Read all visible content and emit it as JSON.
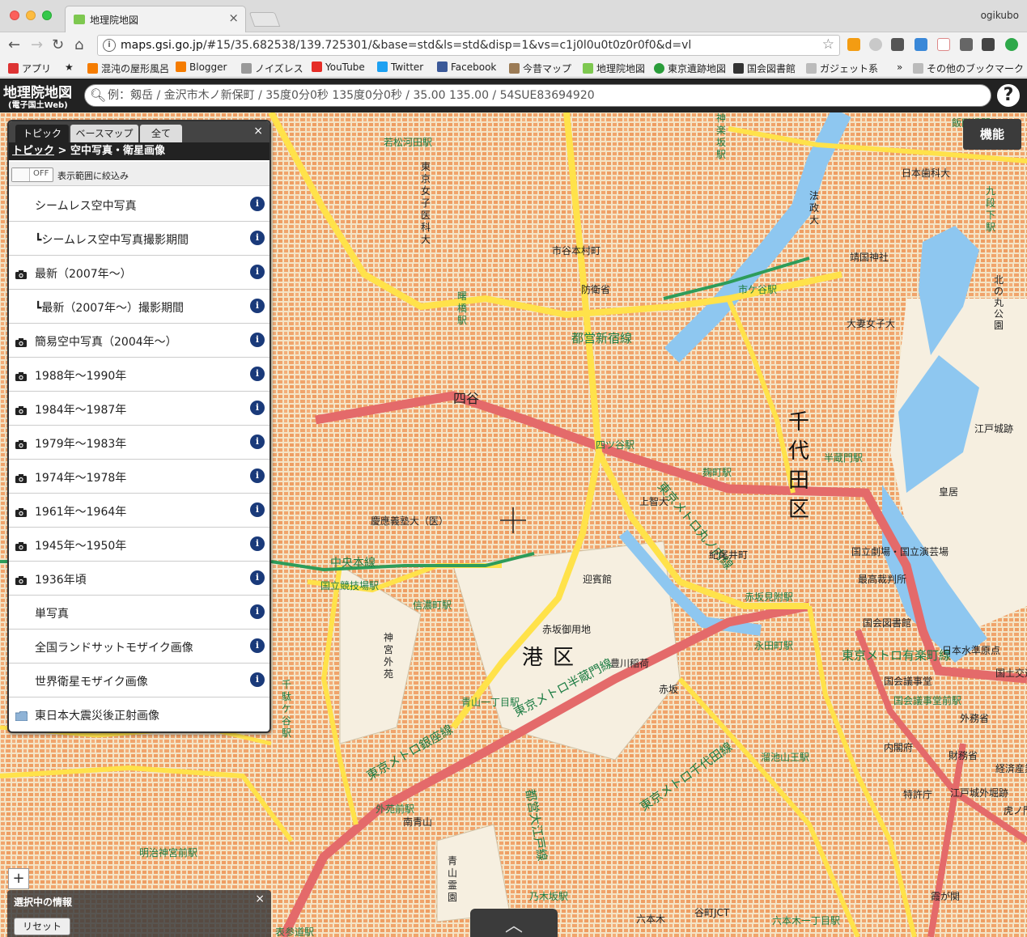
{
  "browser": {
    "tab_title": "地理院地図",
    "profile": "ogikubo",
    "url_host": "maps.gsi.go.jp",
    "url_rest": "/#15/35.682538/139.725301/&base=std&ls=std&disp=1&vs=c1j0l0u0t0z0r0f0&d=vl",
    "bookmarks": [
      "アプリ",
      "混沌の屋形風呂",
      "Blogger",
      "ノイズレス",
      "YouTube",
      "Twitter",
      "Facebook",
      "今昔マップ",
      "地理院地図",
      "東京遺跡地図",
      "国会図書館",
      "ガジェット系",
      "その他のブックマーク"
    ],
    "bookmarks_more": "»"
  },
  "gsi": {
    "logo": "地理院地図",
    "logo_sub": "(電子国土Web)",
    "search_placeholder": "例：剱岳 / 金沢市木ノ新保町 / 35度0分0秒 135度0分0秒 / 35.00 135.00 / 54SUE83694920",
    "help": "?",
    "kino_button": "機能"
  },
  "panel": {
    "tabs": [
      "トピック",
      "ベースマップ",
      "全て"
    ],
    "close": "×",
    "breadcrumb_root": "トピック",
    "breadcrumb_sep": " > ",
    "breadcrumb_current": "空中写真・衛星画像",
    "toggle_text": "OFF",
    "filter_label": "表示範囲に絞込み",
    "items": [
      {
        "label": "シームレス空中写真",
        "icon": "none",
        "info": true
      },
      {
        "label": "┗シームレス空中写真撮影期間",
        "icon": "none",
        "info": true
      },
      {
        "label": "最新（2007年～）",
        "icon": "camera",
        "info": true
      },
      {
        "label": "┗最新（2007年～）撮影期間",
        "icon": "none",
        "info": true
      },
      {
        "label": "簡易空中写真（2004年～）",
        "icon": "camera",
        "info": true
      },
      {
        "label": "1988年～1990年",
        "icon": "camera",
        "info": true
      },
      {
        "label": "1984年～1987年",
        "icon": "camera",
        "info": true
      },
      {
        "label": "1979年～1983年",
        "icon": "camera",
        "info": true
      },
      {
        "label": "1974年～1978年",
        "icon": "camera",
        "info": true
      },
      {
        "label": "1961年～1964年",
        "icon": "camera",
        "info": true
      },
      {
        "label": "1945年～1950年",
        "icon": "camera",
        "info": true
      },
      {
        "label": "1936年頃",
        "icon": "camera",
        "info": true
      },
      {
        "label": "単写真",
        "icon": "none",
        "info": true
      },
      {
        "label": "全国ランドサットモザイク画像",
        "icon": "none",
        "info": true
      },
      {
        "label": "世界衛星モザイク画像",
        "icon": "none",
        "info": true
      },
      {
        "label": "東日本大震災後正射画像",
        "icon": "folder",
        "info": false
      }
    ],
    "info_glyph": "i"
  },
  "selection": {
    "title": "選択中の情報",
    "close": "×",
    "reset": "リセット"
  },
  "map": {
    "zoom_in": "+",
    "bottom_tab": "︿",
    "labels": [
      {
        "text": "千代田区",
        "big": true
      },
      {
        "text": "港区",
        "big": true
      },
      {
        "text": "都営新宿線"
      },
      {
        "text": "東京メトロ丸ノ内線"
      },
      {
        "text": "東京メトロ銀座線"
      },
      {
        "text": "東京メトロ半蔵門線"
      },
      {
        "text": "東京メトロ有楽町線"
      },
      {
        "text": "東京メトロ千代田線"
      },
      {
        "text": "都営大江戸線"
      },
      {
        "text": "中央本線"
      },
      {
        "text": "国立競技場駅"
      },
      {
        "text": "信濃町駅"
      },
      {
        "text": "四ツ谷駅"
      },
      {
        "text": "市ケ谷駅"
      },
      {
        "text": "麹町駅"
      },
      {
        "text": "半蔵門駅"
      },
      {
        "text": "永田町駅"
      },
      {
        "text": "赤坂見附駅"
      },
      {
        "text": "国会議事堂前駅"
      },
      {
        "text": "外苑前駅"
      },
      {
        "text": "青山一丁目駅"
      },
      {
        "text": "明治神宮前駅"
      },
      {
        "text": "表参道駅"
      },
      {
        "text": "赤坂御用地"
      },
      {
        "text": "迎賓館"
      },
      {
        "text": "防衛省"
      },
      {
        "text": "国立劇場・国立演芸場"
      },
      {
        "text": "最高裁判所"
      },
      {
        "text": "国会図書館"
      },
      {
        "text": "国会議事堂"
      },
      {
        "text": "靖国神社"
      },
      {
        "text": "北の丸公園"
      },
      {
        "text": "慶應義塾大（医）"
      },
      {
        "text": "四谷"
      },
      {
        "text": "紀尾井町"
      },
      {
        "text": "霞が関"
      },
      {
        "text": "皇居"
      },
      {
        "text": "市谷本村町"
      },
      {
        "text": "神宮外苑"
      },
      {
        "text": "東京女子医科大"
      },
      {
        "text": "上智大"
      },
      {
        "text": "法政大"
      },
      {
        "text": "日本歯科大"
      },
      {
        "text": "大妻女子大"
      },
      {
        "text": "豊川稲荷"
      },
      {
        "text": "青山霊園"
      },
      {
        "text": "外務省"
      },
      {
        "text": "財務省"
      },
      {
        "text": "経済産業省"
      },
      {
        "text": "特許庁"
      },
      {
        "text": "江戸城外堀跡"
      },
      {
        "text": "江戸城跡"
      },
      {
        "text": "国土交通"
      },
      {
        "text": "日本水準原点"
      },
      {
        "text": "内閣府"
      },
      {
        "text": "虎ノ門"
      },
      {
        "text": "赤坂"
      },
      {
        "text": "六本木"
      },
      {
        "text": "南青山"
      },
      {
        "text": "曙橋駅"
      },
      {
        "text": "若松河田駅"
      },
      {
        "text": "千駄ケ谷駅"
      },
      {
        "text": "神楽坂駅"
      },
      {
        "text": "飯田橋駅"
      },
      {
        "text": "九段下駅"
      },
      {
        "text": "乃木坂駅"
      },
      {
        "text": "溜池山王駅"
      },
      {
        "text": "六本木一丁目駅"
      },
      {
        "text": "谷町JCT"
      }
    ]
  },
  "colors": {
    "browser_chrome": "#dcdcdc",
    "gsi_header": "#222222",
    "map_base": "#f2e3c8",
    "buildings": "#f0a46b",
    "major_road": "#e46a6a",
    "road": "#ffe24a",
    "rail": "#2d9c5a",
    "water": "#8ec7f0",
    "info_button": "#1a3a7a"
  }
}
